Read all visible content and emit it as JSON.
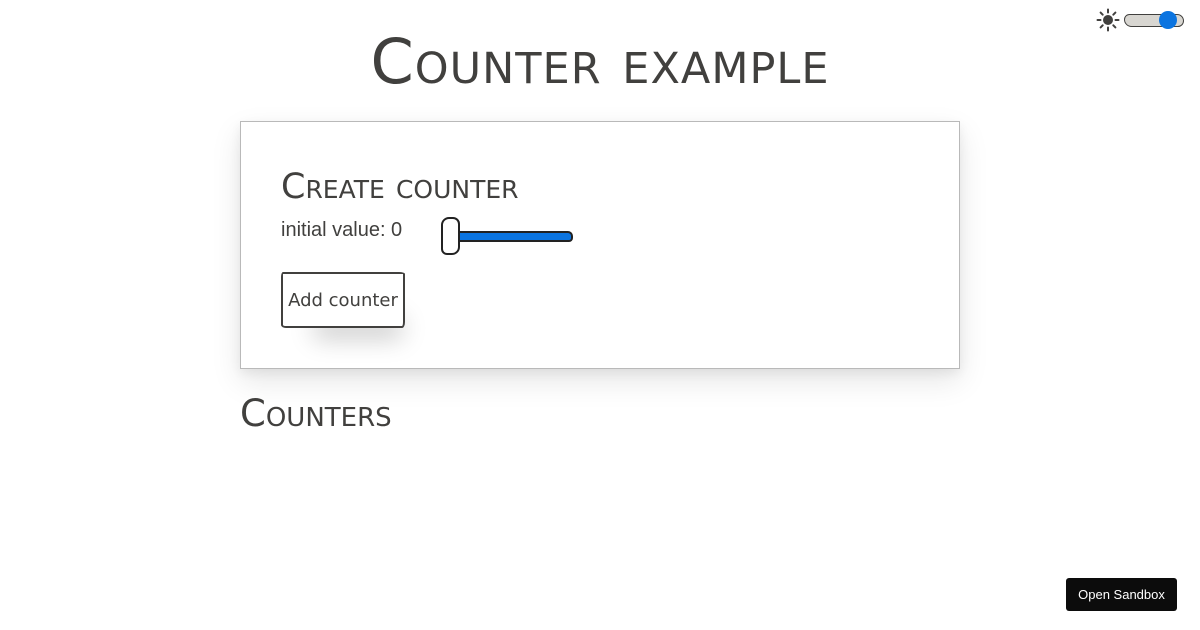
{
  "page": {
    "title": "Counter example"
  },
  "theme_toggle": {
    "icon": "sun-icon",
    "enabled": true,
    "accent_color": "#0b74e0"
  },
  "create_card": {
    "title": "Create counter",
    "initial_value_label": "initial value: 0",
    "slider": {
      "value": 0,
      "fill_fraction": 0
    },
    "add_button_label": "Add counter"
  },
  "counters_section": {
    "title": "Counters"
  },
  "sandbox_button": {
    "label": "Open Sandbox"
  },
  "colors": {
    "text": "#41403e",
    "accent": "#0b74e0",
    "background": "#ffffff",
    "sandbox_button_bg": "#0c0c0c"
  }
}
